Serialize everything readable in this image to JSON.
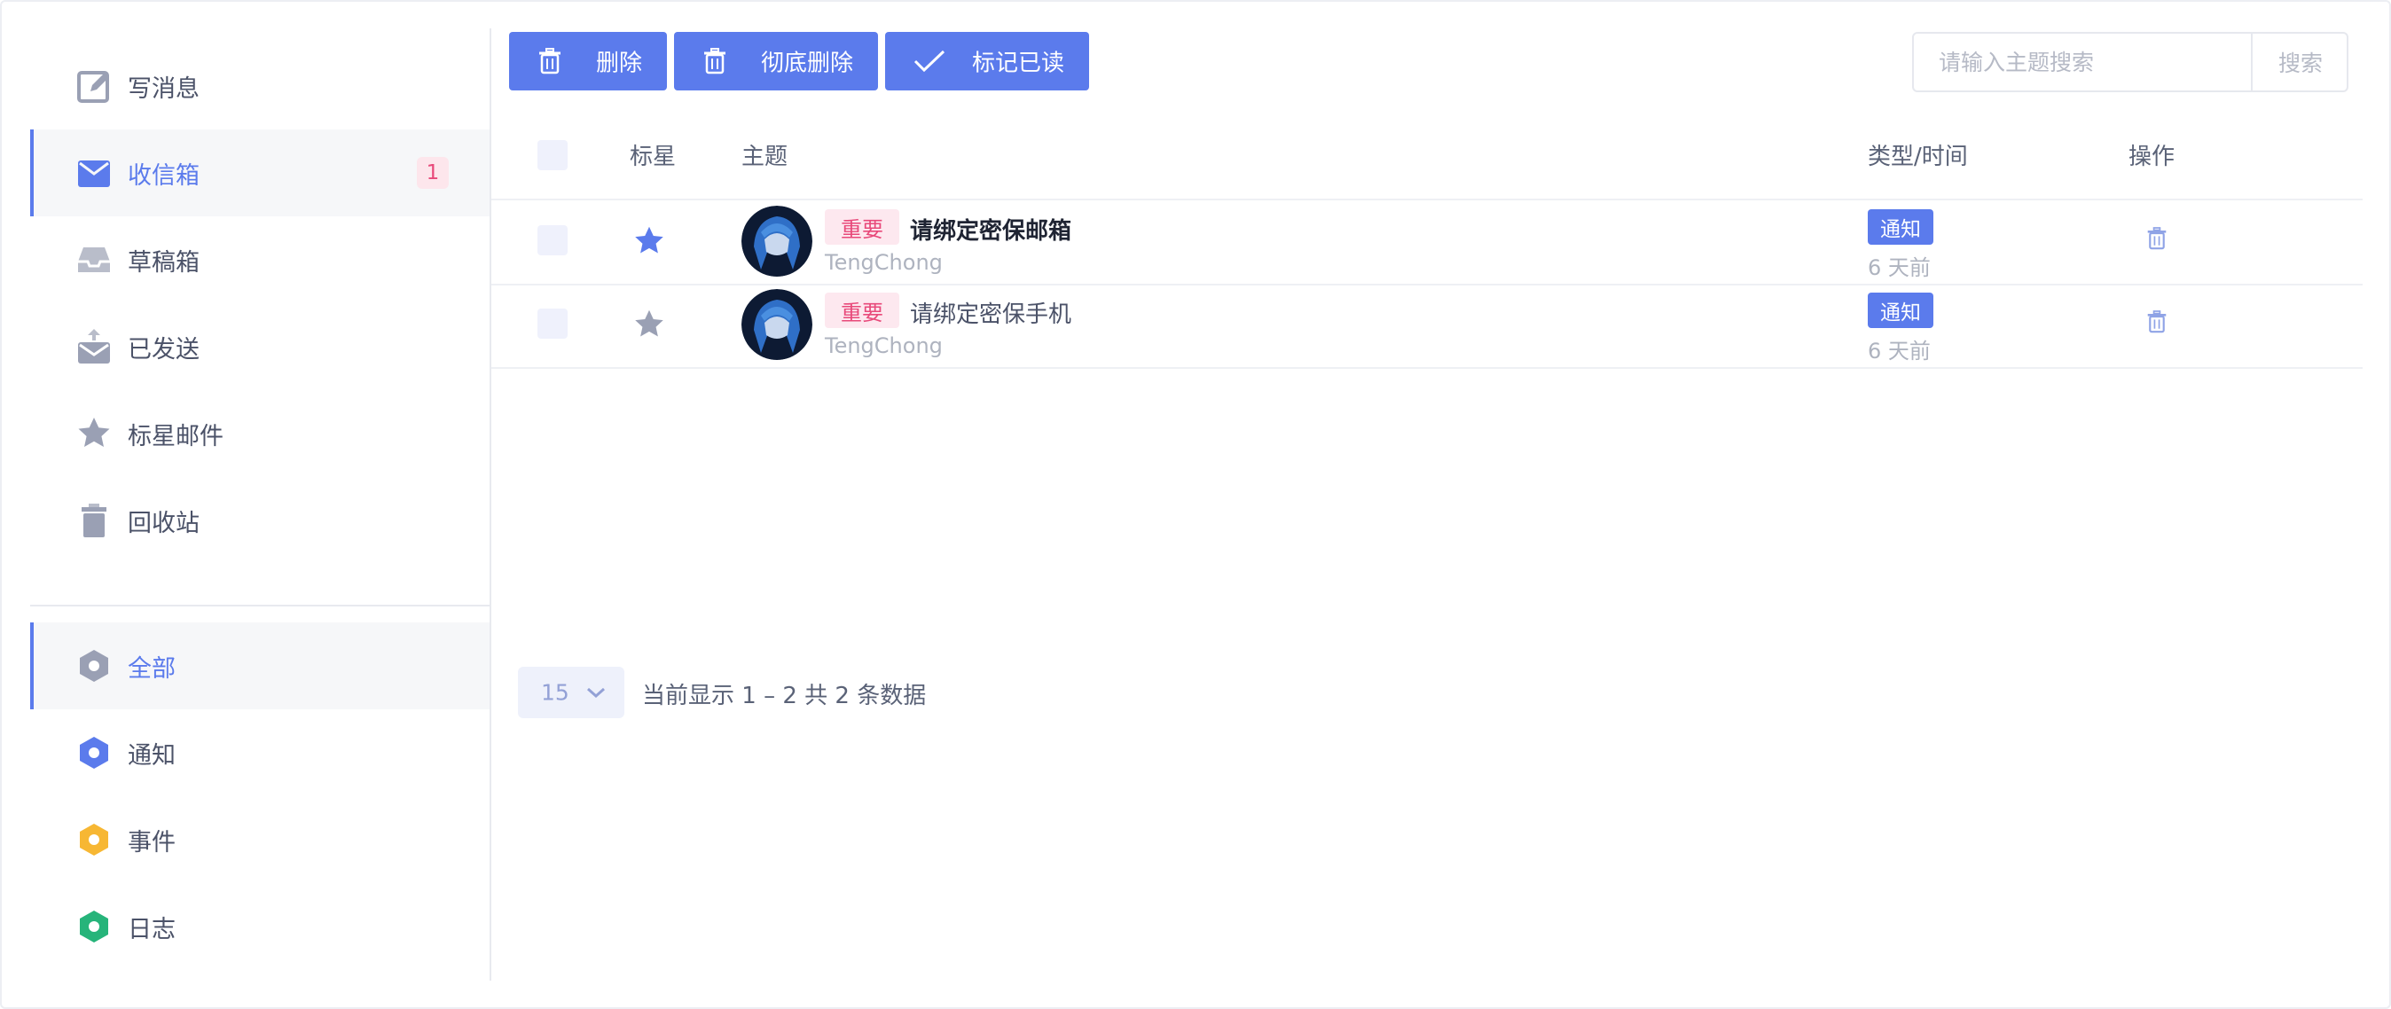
{
  "sidebar": {
    "items": [
      {
        "label": "写消息",
        "icon": "edit-icon"
      },
      {
        "label": "收信箱",
        "icon": "mail-icon",
        "badge": "1",
        "active": true
      },
      {
        "label": "草稿箱",
        "icon": "inbox-tray-icon"
      },
      {
        "label": "已发送",
        "icon": "sent-icon"
      },
      {
        "label": "标星邮件",
        "icon": "star-icon"
      },
      {
        "label": "回收站",
        "icon": "trash-icon"
      }
    ],
    "filters": [
      {
        "label": "全部",
        "color": "#9aa0b4",
        "active": true
      },
      {
        "label": "通知",
        "color": "#5b7bec"
      },
      {
        "label": "事件",
        "color": "#f7b733"
      },
      {
        "label": "日志",
        "color": "#26b47a"
      }
    ]
  },
  "toolbar": {
    "delete_label": "删除",
    "perm_delete_label": "彻底删除",
    "mark_read_label": "标记已读"
  },
  "search": {
    "placeholder": "请输入主题搜索",
    "button_label": "搜索"
  },
  "table": {
    "headers": {
      "star": "标星",
      "subject": "主题",
      "type_time": "类型/时间",
      "actions": "操作"
    },
    "rows": [
      {
        "starred": true,
        "tag": "重要",
        "subject": "请绑定密保邮箱",
        "sender": "TengChong",
        "type": "通知",
        "time": "6 天前",
        "unread": true
      },
      {
        "starred": false,
        "tag": "重要",
        "subject": "请绑定密保手机",
        "sender": "TengChong",
        "type": "通知",
        "time": "6 天前",
        "unread": false
      }
    ]
  },
  "pagination": {
    "page_size": "15",
    "info": "当前显示 1 – 2 共 2 条数据"
  },
  "colors": {
    "accent": "#5b7bec",
    "important": "#e8497a",
    "star_active": "#5b7bec",
    "star_inactive": "#9aa0b4"
  }
}
